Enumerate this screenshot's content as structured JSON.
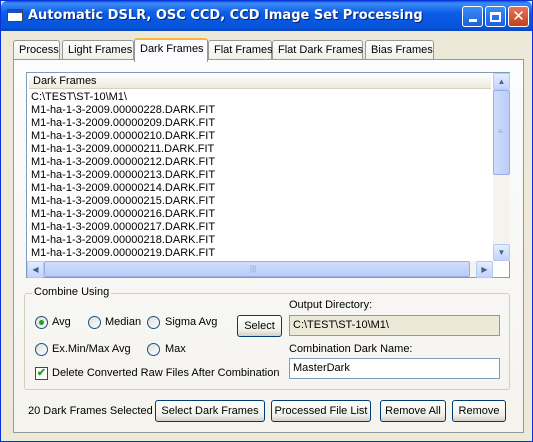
{
  "window": {
    "title": "Automatic DSLR, OSC CCD, CCD Image Set Processing"
  },
  "tabs": [
    {
      "label": "Process"
    },
    {
      "label": "Light Frames"
    },
    {
      "label": "Dark Frames",
      "active": true
    },
    {
      "label": "Flat Frames"
    },
    {
      "label": "Flat Dark Frames"
    },
    {
      "label": "Bias Frames"
    }
  ],
  "dark_frames_list": {
    "header": "Dark Frames",
    "items": [
      "C:\\TEST\\ST-10\\M1\\",
      "M1-ha-1-3-2009.00000228.DARK.FIT",
      "M1-ha-1-3-2009.00000209.DARK.FIT",
      "M1-ha-1-3-2009.00000210.DARK.FIT",
      "M1-ha-1-3-2009.00000211.DARK.FIT",
      "M1-ha-1-3-2009.00000212.DARK.FIT",
      "M1-ha-1-3-2009.00000213.DARK.FIT",
      "M1-ha-1-3-2009.00000214.DARK.FIT",
      "M1-ha-1-3-2009.00000215.DARK.FIT",
      "M1-ha-1-3-2009.00000216.DARK.FIT",
      "M1-ha-1-3-2009.00000217.DARK.FIT",
      "M1-ha-1-3-2009.00000218.DARK.FIT",
      "M1-ha-1-3-2009.00000219.DARK.FIT"
    ]
  },
  "combine": {
    "group_label": "Combine Using",
    "options": {
      "avg": "Avg",
      "median": "Median",
      "sigma_avg": "Sigma Avg",
      "ex_minmax_avg": "Ex.Min/Max Avg",
      "max": "Max"
    },
    "selected": "Avg",
    "select_button": "Select",
    "delete_converted_label": "Delete Converted Raw Files After Combination",
    "delete_converted_checked": true,
    "output_directory_label": "Output Directory:",
    "output_directory_value": "C:\\TEST\\ST-10\\M1\\",
    "combination_name_label": "Combination Dark Name:",
    "combination_name_value": "MasterDark"
  },
  "footer": {
    "status": "20 Dark Frames Selected",
    "select_button": "Select Dark Frames",
    "processed_button": "Processed File List",
    "remove_all_button": "Remove All",
    "remove_button": "Remove"
  }
}
